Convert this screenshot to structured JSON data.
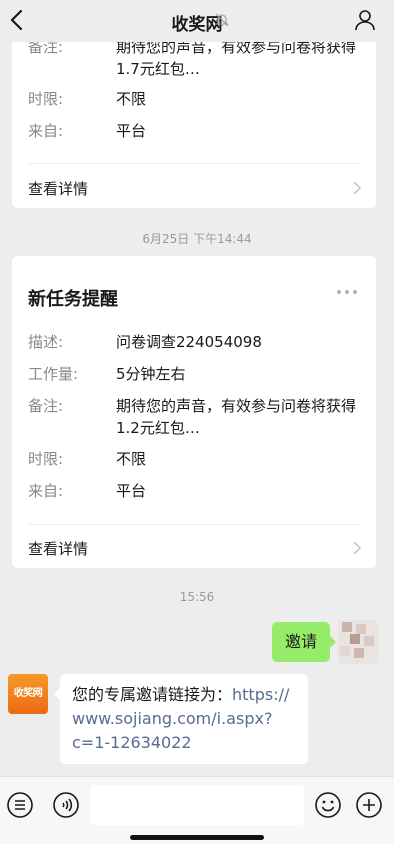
{
  "nav": {
    "title": "收奖网"
  },
  "card1": {
    "rows": [
      {
        "key": "备注:",
        "value_line1": "期待您的声音，有效参与问卷将获得",
        "value_line2": "1.7元红包…"
      },
      {
        "key": "时限:",
        "value": "不限"
      },
      {
        "key": "来自:",
        "value": "平台"
      }
    ],
    "detail": "查看详情"
  },
  "timestamp1": "6月25日 下午14:44",
  "card2": {
    "title": "新任务提醒",
    "rows": [
      {
        "key": "描述:",
        "value": "问卷调查224054098"
      },
      {
        "key": "工作量:",
        "value": "5分钟左右"
      },
      {
        "key": "备注:",
        "value_line1": "期待您的声音，有效参与问卷将获得",
        "value_line2": "1.2元红包…"
      },
      {
        "key": "时限:",
        "value": "不限"
      },
      {
        "key": "来自:",
        "value": "平台"
      }
    ],
    "detail": "查看详情"
  },
  "timestamp2": "15:56",
  "sent_message": "邀请",
  "bot": {
    "avatar_text": "收奖网",
    "message_prefix": "您的专属邀请链接为：",
    "link_part1": "https://",
    "link_part2": "www.sojiang.com/i.aspx?",
    "link_part3": "c=1-12634022"
  },
  "icons": [
    "back-icon",
    "mute-bell-icon",
    "profile-icon",
    "more-dots-icon",
    "chevron-right-icon",
    "menu-list-icon",
    "voice-icon",
    "emoji-icon",
    "plus-icon"
  ]
}
